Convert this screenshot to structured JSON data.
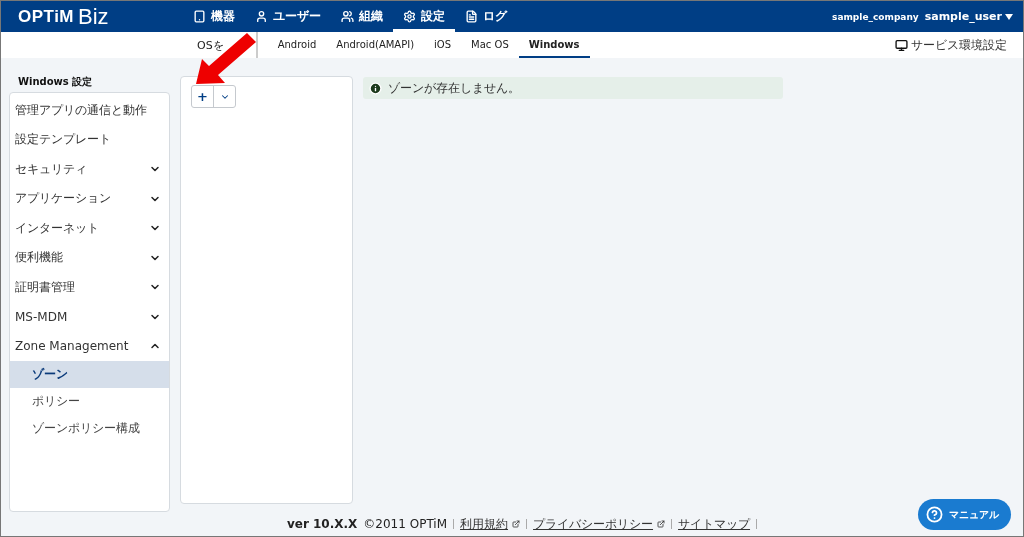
{
  "header": {
    "logo_bold": "OPTiM",
    "logo_light": "Biz",
    "nav": [
      {
        "label": "機器",
        "selected": false
      },
      {
        "label": "ユーザー",
        "selected": false
      },
      {
        "label": "組織",
        "selected": false
      },
      {
        "label": "設定",
        "selected": true
      },
      {
        "label": "ログ",
        "selected": false
      }
    ],
    "company": "sample_company",
    "user": "sample_user"
  },
  "os_tabs": [
    {
      "label": "OSを",
      "selected": false
    },
    {
      "label": "Android",
      "selected": false
    },
    {
      "label": "Android(AMAPI)",
      "selected": false
    },
    {
      "label": "iOS",
      "selected": false
    },
    {
      "label": "Mac OS",
      "selected": false
    },
    {
      "label": "Windows",
      "selected": true
    }
  ],
  "service_settings": "サービス環境設定",
  "sidebar": {
    "title": "Windows 設定",
    "items": [
      {
        "label": "管理アプリの通信と動作",
        "kind": "link"
      },
      {
        "label": "設定テンプレート",
        "kind": "link"
      },
      {
        "label": "セキュリティ",
        "kind": "group",
        "expanded": false
      },
      {
        "label": "アプリケーション",
        "kind": "group",
        "expanded": false
      },
      {
        "label": "インターネット",
        "kind": "group",
        "expanded": false
      },
      {
        "label": "便利機能",
        "kind": "group",
        "expanded": false
      },
      {
        "label": "証明書管理",
        "kind": "group",
        "expanded": false
      },
      {
        "label": "MS-MDM",
        "kind": "group",
        "expanded": false
      },
      {
        "label": "Zone Management",
        "kind": "group",
        "expanded": true,
        "children": [
          {
            "label": "ゾーン",
            "selected": true
          },
          {
            "label": "ポリシー",
            "selected": false
          },
          {
            "label": "ゾーンポリシー構成",
            "selected": false
          }
        ]
      }
    ]
  },
  "add_button": "+",
  "alert": "ゾーンが存在しません。",
  "footer": {
    "version": "ver 10.X.X",
    "copyright": "©2011 OPTiM",
    "links": [
      {
        "label": "利用規約",
        "external": true
      },
      {
        "label": "プライバシーポリシー",
        "external": true
      },
      {
        "label": "サイトマップ",
        "external": false
      }
    ]
  },
  "manual_button": "マニュアル"
}
